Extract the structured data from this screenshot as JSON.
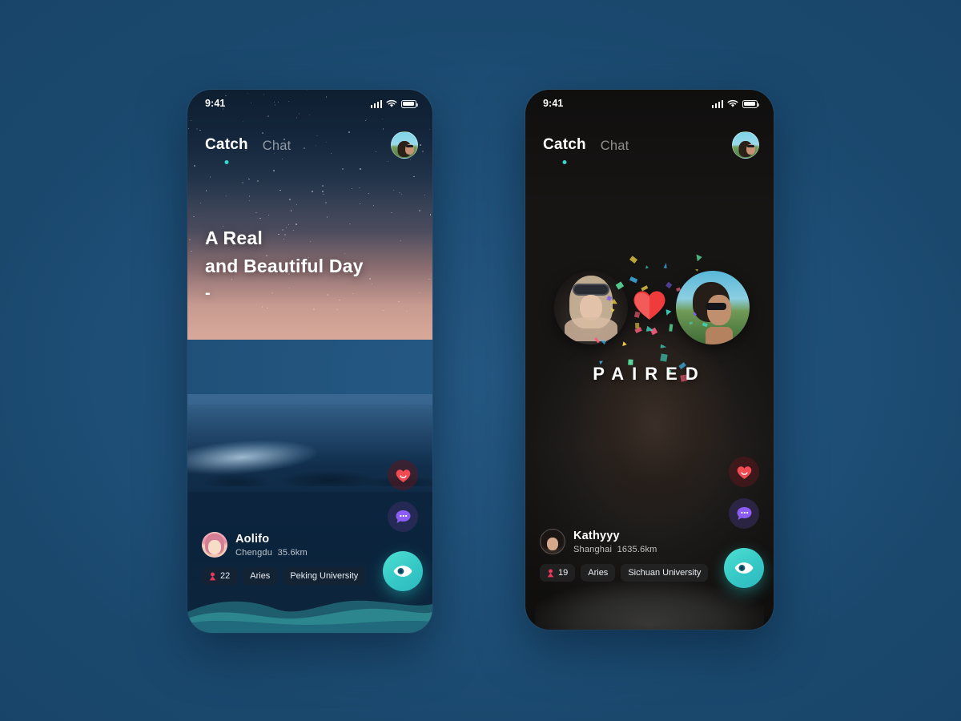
{
  "canvas": {
    "background_color": "#1b4a70"
  },
  "phone_one": {
    "status_bar": {
      "time": "9:41",
      "signal_icon": "cellular-bars-icon",
      "wifi_icon": "wifi-icon",
      "battery_icon": "battery-icon"
    },
    "nav": {
      "active_tab": "Catch",
      "inactive_tab": "Chat",
      "avatar_icon": "user-avatar"
    },
    "hero": {
      "line1": "A Real",
      "line2": "and Beautiful Day",
      "dash": "-"
    },
    "actions": {
      "like_icon": "heart-icon",
      "chat_icon": "chat-bubble-icon",
      "view_icon": "eye-icon"
    },
    "profile": {
      "name": "Aolifo",
      "city": "Chengdu",
      "distance": "35.6km",
      "age": "22",
      "gender_icon": "female-icon",
      "zodiac": "Aries",
      "school": "Peking University"
    }
  },
  "phone_two": {
    "status_bar": {
      "time": "9:41",
      "signal_icon": "cellular-bars-icon",
      "wifi_icon": "wifi-icon",
      "battery_icon": "battery-icon"
    },
    "nav": {
      "active_tab": "Catch",
      "inactive_tab": "Chat",
      "avatar_icon": "user-avatar"
    },
    "paired": {
      "label": "PAIRED",
      "left_avatar_icon": "matched-user-left-avatar",
      "right_avatar_icon": "matched-user-right-avatar",
      "heart_icon": "heart-icon",
      "confetti_icon": "confetti-icon"
    },
    "actions": {
      "like_icon": "heart-icon",
      "chat_icon": "chat-bubble-icon",
      "view_icon": "eye-icon"
    },
    "profile": {
      "name": "Kathyyy",
      "city": "Shanghai",
      "distance": "1635.6km",
      "age": "19",
      "gender_icon": "female-icon",
      "zodiac": "Aries",
      "school": "Sichuan University"
    }
  },
  "colors": {
    "accent_teal": "#35d9cf",
    "like_red": "#f0484f",
    "chat_purple": "#8b5cf6",
    "background": "#1b4a70"
  }
}
